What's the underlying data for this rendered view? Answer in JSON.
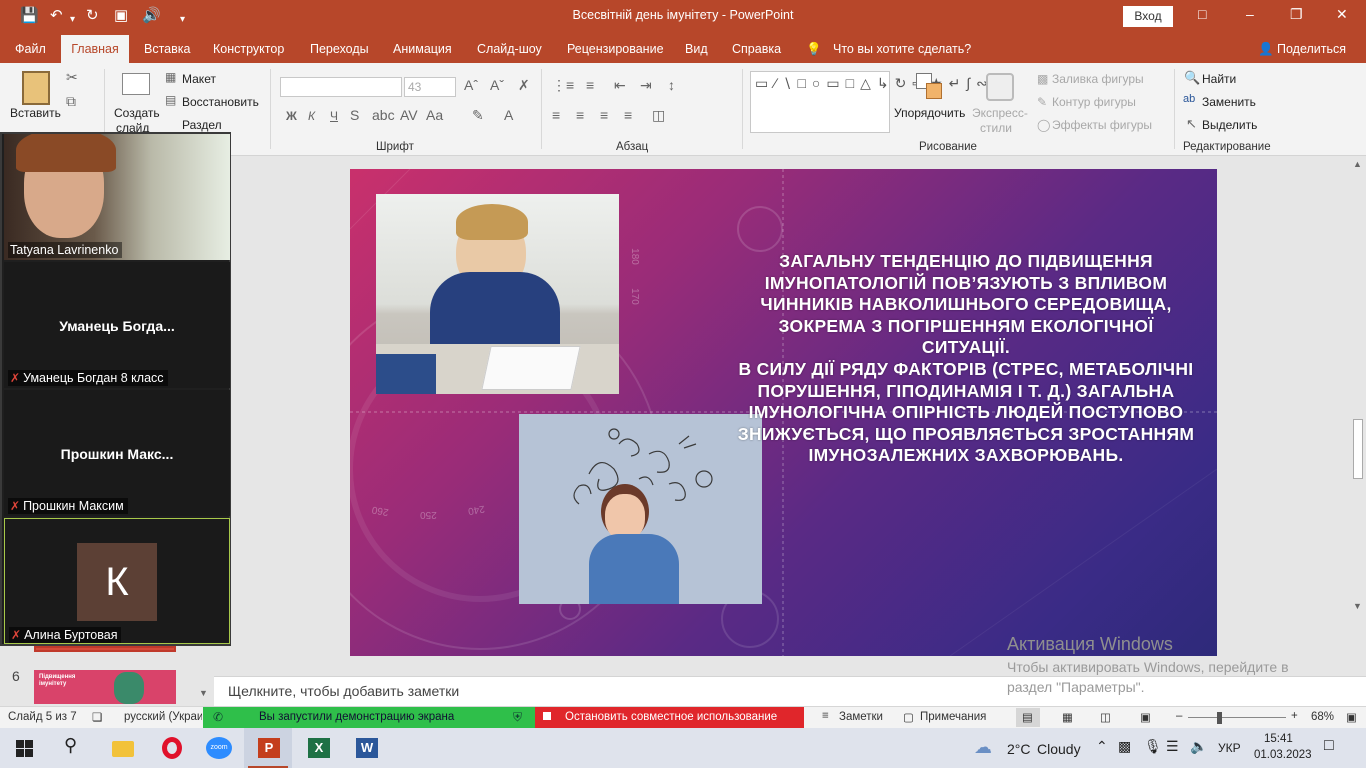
{
  "window": {
    "title": "Всесвітній день імунітету  -  PowerPoint",
    "signin": "Вход"
  },
  "tabs": [
    "Файл",
    "Главная",
    "Вставка",
    "Конструктор",
    "Переходы",
    "Анимация",
    "Слайд-шоу",
    "Рецензирование",
    "Вид",
    "Справка"
  ],
  "tell_me": "Что вы хотите сделать?",
  "share": "Поделиться",
  "ribbon": {
    "paste": "Вставить",
    "new_slide_1": "Создать",
    "new_slide_2": "слайд",
    "layout": "Макет",
    "reset": "Восстановить",
    "section": "Раздел",
    "font_size": "43",
    "bold": "Ж",
    "italic": "К",
    "underline": "Ч",
    "group_font": "Шрифт",
    "group_paragraph": "Абзац",
    "group_drawing": "Рисование",
    "group_editing": "Редактирование",
    "arrange": "Упорядочить",
    "quick_styles_1": "Экспресс-",
    "quick_styles_2": "стили",
    "shape_fill": "Заливка фигуры",
    "shape_outline": "Контур фигуры",
    "shape_effects": "Эффекты фигуры",
    "find": "Найти",
    "replace": "Заменить",
    "select": "Выделить"
  },
  "participants": [
    {
      "name": "Tatyana Lavrinenko"
    },
    {
      "display": "Уманець  Богда...",
      "label": "Уманець Богдан 8 класс"
    },
    {
      "display": "Прошкин  Макс...",
      "label": "Прошкин Максим"
    },
    {
      "initial": "К",
      "label": "Алина Буртовая"
    }
  ],
  "slide": {
    "text": "Загальну тенденцію до підвищення імунопатологій пов’язують з впливом чинників навколишнього середовища, зокрема з погіршенням екологічної ситуації.\nВ силу дії ряду факторів (стрес, метаболічні порушення, гіподинамія і т. д.) загальна імунологічна опірність людей поступово знижується, що проявляється зростанням імунозалежних захворювань.",
    "dial_numbers": [
      "170",
      "180",
      "250",
      "240",
      "260"
    ]
  },
  "thumbnail": {
    "number": "6",
    "title": "Підвищення імунітету"
  },
  "notes_placeholder": "Щелкните, чтобы добавить заметки",
  "activation": {
    "title": "Активация Windows",
    "body": "Чтобы активировать Windows, перейдите в раздел \"Параметры\"."
  },
  "status": {
    "slide": "Слайд 5 из 7",
    "lang": "русский (Украи",
    "sharing": "Вы запустили демонстрацию экрана",
    "stop": "Остановить совместное использование",
    "notes": "Заметки",
    "comments": "Примечания",
    "zoom": "68%"
  },
  "taskbar": {
    "weather_temp": "2°C",
    "weather": "Cloudy",
    "lang": "УКР",
    "time": "15:41",
    "date": "01.03.2023"
  },
  "colors": {
    "accent": "#b7472a",
    "sharing_green": "#2fbf4a",
    "stop_red": "#e0262b"
  }
}
